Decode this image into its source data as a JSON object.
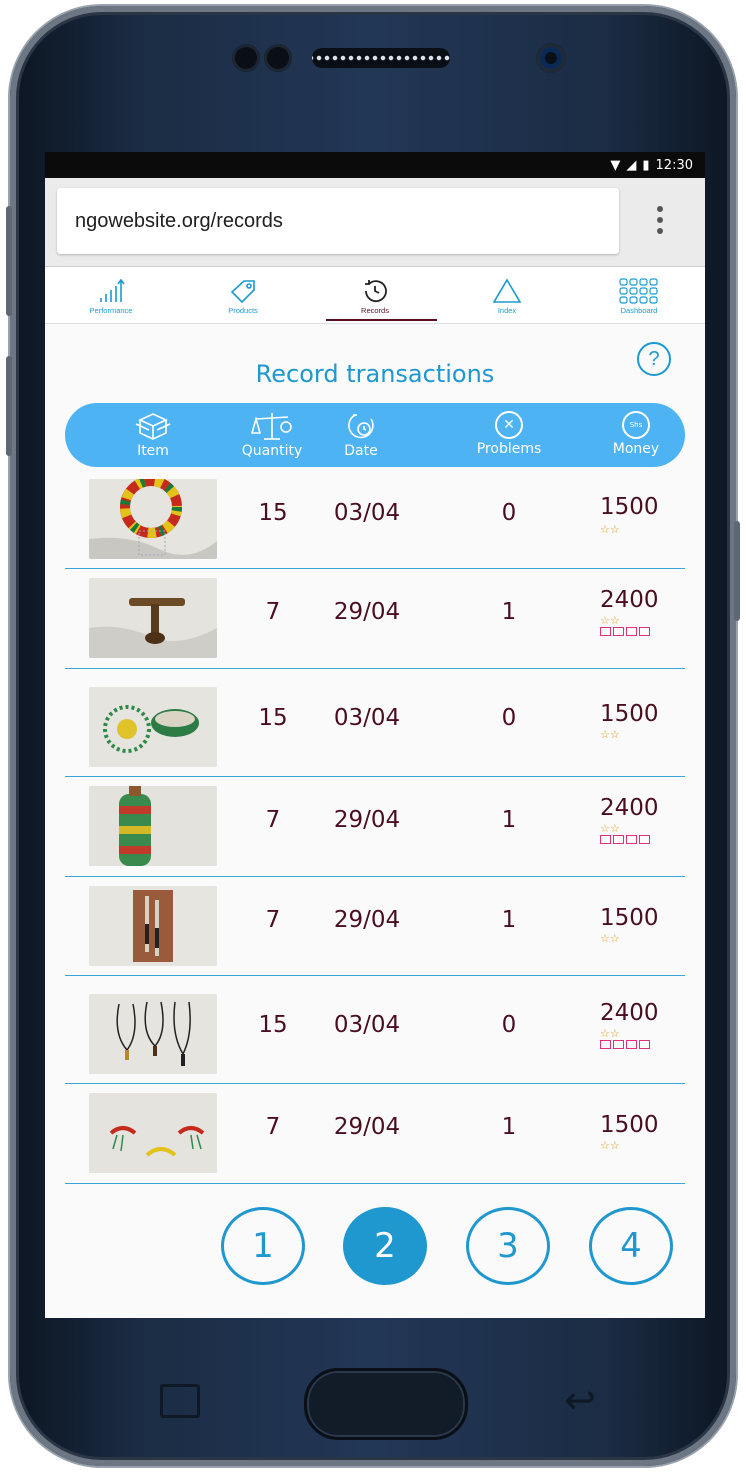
{
  "status_bar": {
    "time": "12:30"
  },
  "browser": {
    "url": "ngowebsite.org/records"
  },
  "tabs": [
    {
      "label": "Performance",
      "icon": "bar-chart-icon",
      "active": false
    },
    {
      "label": "Products",
      "icon": "price-tag-icon",
      "active": false
    },
    {
      "label": "Records",
      "icon": "history-clock-icon",
      "active": true
    },
    {
      "label": "Index",
      "icon": "triangle-icon",
      "active": false
    },
    {
      "label": "Dashboard",
      "icon": "grid-icon",
      "active": false
    }
  ],
  "help": {
    "symbol": "?"
  },
  "page": {
    "title": "Record transactions"
  },
  "columns": {
    "item": "Item",
    "quantity": "Quantity",
    "date": "Date",
    "problems": "Problems",
    "money": "Money",
    "money_icon_text": "Shs"
  },
  "rows": [
    {
      "image": "beaded-collar-necklace",
      "quantity": "15",
      "date": "03/04",
      "problems": "0",
      "money": "1500",
      "stars": "☆☆",
      "boxes": 0
    },
    {
      "image": "wooden-headrest",
      "quantity": "7",
      "date": "29/04",
      "problems": "1",
      "money": "2400",
      "stars": "☆☆",
      "boxes": 4
    },
    {
      "image": "beaded-basket-and-mat",
      "quantity": "15",
      "date": "03/04",
      "problems": "0",
      "money": "1500",
      "stars": "☆☆",
      "boxes": 0
    },
    {
      "image": "beaded-gourd-bottle",
      "quantity": "7",
      "date": "29/04",
      "problems": "1",
      "money": "2400",
      "stars": "☆☆",
      "boxes": 4
    },
    {
      "image": "beaded-letter-openers",
      "quantity": "7",
      "date": "29/04",
      "problems": "1",
      "money": "1500",
      "stars": "☆☆",
      "boxes": 0
    },
    {
      "image": "pendant-necklaces",
      "quantity": "15",
      "date": "03/04",
      "problems": "0",
      "money": "2400",
      "stars": "☆☆",
      "boxes": 4
    },
    {
      "image": "beaded-bracelets",
      "quantity": "7",
      "date": "29/04",
      "problems": "1",
      "money": "1500",
      "stars": "☆☆",
      "boxes": 0
    }
  ],
  "pagination": {
    "pages": [
      "1",
      "2",
      "3",
      "4"
    ],
    "current": "2"
  },
  "colors": {
    "accent": "#1f97cf",
    "header_pill": "#4db3f2",
    "text_dark": "#4a0f1e",
    "star": "#e09a1a",
    "box": "#e0317a",
    "active_tab": "#5b1020"
  }
}
